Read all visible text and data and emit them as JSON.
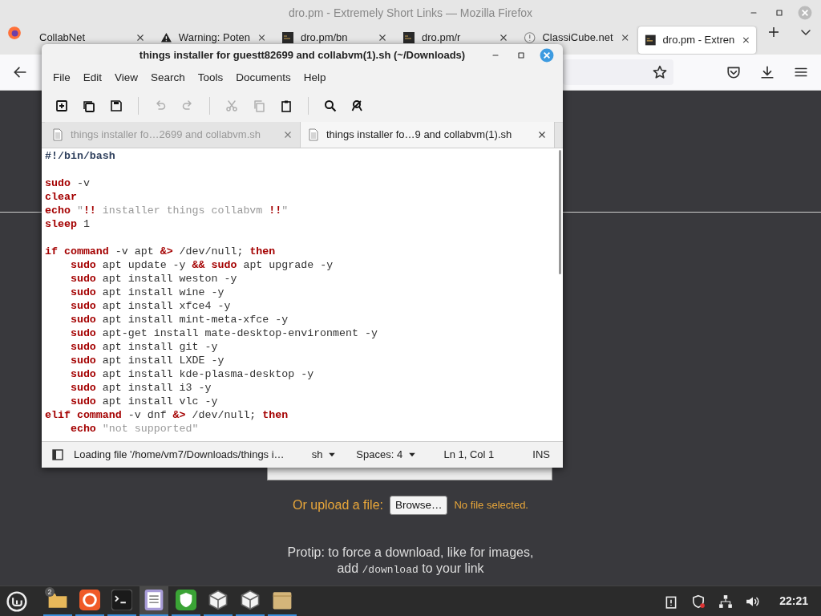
{
  "firefox": {
    "title": "dro.pm - Extremely Short Links — Mozilla Firefox",
    "tabs": [
      {
        "label": "CollabNet",
        "kind": "plain",
        "selected": false
      },
      {
        "label": "Warning: Poten",
        "kind": "warning",
        "selected": false
      },
      {
        "label": "dro.pm/bn",
        "kind": "page",
        "selected": false
      },
      {
        "label": "dro.pm/r",
        "kind": "page",
        "selected": false
      },
      {
        "label": "ClassiCube.net",
        "kind": "globe",
        "selected": false
      },
      {
        "label": "dro.pm - Extren",
        "kind": "page",
        "selected": true
      }
    ]
  },
  "page": {
    "upload_label": "Or upload a file:",
    "browse_button": "Browse…",
    "no_file": "No file selected.",
    "protip_line1": "Protip: to force a download, like for images,",
    "protip_add": "add",
    "protip_code": "/download",
    "protip_rest": "to your link"
  },
  "editor": {
    "title": "things installer for guestt82699 and collabvm(1).sh (~/Downloads)",
    "menu": [
      "File",
      "Edit",
      "View",
      "Search",
      "Tools",
      "Documents",
      "Help"
    ],
    "toolbar_groups": [
      [
        {
          "kind": "new",
          "disabled": false
        },
        {
          "kind": "windows",
          "disabled": false
        },
        {
          "kind": "save",
          "disabled": false
        }
      ],
      [
        {
          "kind": "undo",
          "disabled": true
        },
        {
          "kind": "redo",
          "disabled": true
        }
      ],
      [
        {
          "kind": "cut",
          "disabled": true
        },
        {
          "kind": "copy",
          "disabled": true
        },
        {
          "kind": "paste",
          "disabled": false
        }
      ],
      [
        {
          "kind": "search",
          "disabled": false
        },
        {
          "kind": "replace",
          "disabled": false
        }
      ]
    ],
    "doc_tabs": [
      {
        "label": "things installer fo…2699 and collabvm.sh",
        "selected": false
      },
      {
        "label": "things installer fo…9 and collabvm(1).sh",
        "selected": true
      }
    ],
    "lines": [
      {
        "kind": "code",
        "tokens": [
          {
            "kind": "shebang",
            "text": "#!/bin/bash"
          }
        ]
      },
      {
        "kind": "blank"
      },
      {
        "kind": "code",
        "tokens": [
          {
            "kind": "kw",
            "text": "sudo"
          },
          {
            "kind": "txt",
            "text": " -v"
          }
        ]
      },
      {
        "kind": "code",
        "tokens": [
          {
            "kind": "kw",
            "text": "clear"
          }
        ]
      },
      {
        "kind": "code",
        "tokens": [
          {
            "kind": "kw",
            "text": "echo"
          },
          {
            "kind": "str",
            "text": " \""
          },
          {
            "kind": "kw",
            "text": "!!"
          },
          {
            "kind": "str",
            "text": " installer things collabvm "
          },
          {
            "kind": "kw",
            "text": "!!"
          },
          {
            "kind": "str",
            "text": "\""
          }
        ]
      },
      {
        "kind": "code",
        "tokens": [
          {
            "kind": "kw",
            "text": "sleep"
          },
          {
            "kind": "txt",
            "text": " 1"
          }
        ]
      },
      {
        "kind": "blank"
      },
      {
        "kind": "code",
        "tokens": [
          {
            "kind": "kw",
            "text": "if"
          },
          {
            "kind": "kw",
            "text": " command"
          },
          {
            "kind": "txt",
            "text": " -v apt "
          },
          {
            "kind": "kw",
            "text": "&>"
          },
          {
            "kind": "txt",
            "text": " /dev/null; "
          },
          {
            "kind": "kw",
            "text": "then"
          }
        ]
      },
      {
        "kind": "code",
        "tokens": [
          {
            "kind": "kw",
            "text": "    sudo"
          },
          {
            "kind": "txt",
            "text": " apt update -y "
          },
          {
            "kind": "kw",
            "text": "&&"
          },
          {
            "kind": "kw",
            "text": " sudo"
          },
          {
            "kind": "txt",
            "text": " apt upgrade -y"
          }
        ]
      },
      {
        "kind": "code",
        "tokens": [
          {
            "kind": "kw",
            "text": "    sudo"
          },
          {
            "kind": "txt",
            "text": " apt install weston -y"
          }
        ]
      },
      {
        "kind": "code",
        "tokens": [
          {
            "kind": "kw",
            "text": "    sudo"
          },
          {
            "kind": "txt",
            "text": " apt install wine -y"
          }
        ]
      },
      {
        "kind": "code",
        "tokens": [
          {
            "kind": "kw",
            "text": "    sudo"
          },
          {
            "kind": "txt",
            "text": " apt install xfce4 -y"
          }
        ]
      },
      {
        "kind": "code",
        "tokens": [
          {
            "kind": "kw",
            "text": "    sudo"
          },
          {
            "kind": "txt",
            "text": " apt install mint-meta-xfce -y"
          }
        ]
      },
      {
        "kind": "code",
        "tokens": [
          {
            "kind": "kw",
            "text": "    sudo"
          },
          {
            "kind": "txt",
            "text": " apt-get install mate-desktop-environment -y"
          }
        ]
      },
      {
        "kind": "code",
        "tokens": [
          {
            "kind": "kw",
            "text": "    sudo"
          },
          {
            "kind": "txt",
            "text": " apt install git -y"
          }
        ]
      },
      {
        "kind": "code",
        "tokens": [
          {
            "kind": "kw",
            "text": "    sudo"
          },
          {
            "kind": "txt",
            "text": " apt install LXDE -y"
          }
        ]
      },
      {
        "kind": "code",
        "tokens": [
          {
            "kind": "kw",
            "text": "    sudo"
          },
          {
            "kind": "txt",
            "text": " apt install kde-plasma-desktop -y"
          }
        ]
      },
      {
        "kind": "code",
        "tokens": [
          {
            "kind": "kw",
            "text": "    sudo"
          },
          {
            "kind": "txt",
            "text": " apt install i3 -y"
          }
        ]
      },
      {
        "kind": "code",
        "tokens": [
          {
            "kind": "kw",
            "text": "    sudo"
          },
          {
            "kind": "txt",
            "text": " apt install vlc -y"
          }
        ]
      },
      {
        "kind": "code",
        "tokens": [
          {
            "kind": "kw",
            "text": "elif"
          },
          {
            "kind": "kw",
            "text": " command"
          },
          {
            "kind": "txt",
            "text": " -v dnf "
          },
          {
            "kind": "kw",
            "text": "&>"
          },
          {
            "kind": "txt",
            "text": " /dev/null; "
          },
          {
            "kind": "kw",
            "text": "then"
          }
        ]
      },
      {
        "kind": "code",
        "tokens": [
          {
            "kind": "kw",
            "text": "    echo"
          },
          {
            "kind": "str",
            "text": " \"not supported\""
          }
        ]
      }
    ],
    "status": {
      "message": "Loading file '/home/vm7/Downloads/things i…",
      "language": "sh",
      "indent": "Spaces: 4",
      "position": "Ln 1, Col 1",
      "mode": "INS"
    }
  },
  "taskbar": {
    "items": [
      {
        "kind": "folder",
        "badge": "2",
        "selected": false
      },
      {
        "kind": "firefox",
        "selected": false
      },
      {
        "kind": "terminal",
        "selected": false
      },
      {
        "kind": "editor",
        "selected": true
      },
      {
        "kind": "shield",
        "selected": false
      },
      {
        "kind": "cube",
        "selected": false
      },
      {
        "kind": "cube",
        "selected": false
      },
      {
        "kind": "box",
        "selected": false
      }
    ],
    "tray": [
      {
        "kind": "clipboard"
      },
      {
        "kind": "shield"
      },
      {
        "kind": "network"
      },
      {
        "kind": "volume"
      }
    ],
    "clock": "22:21"
  }
}
